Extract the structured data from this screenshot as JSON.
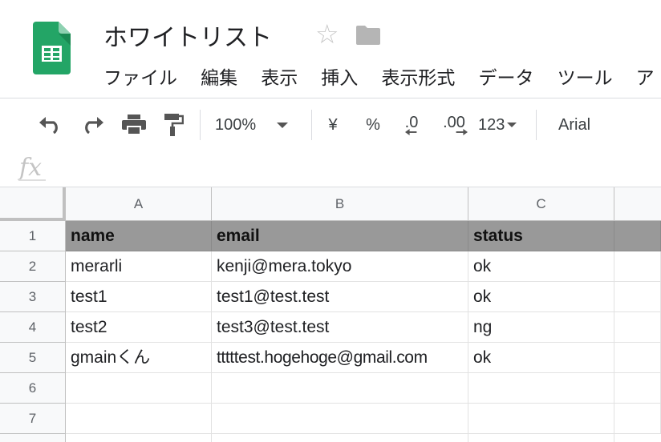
{
  "document": {
    "title": "ホワイトリスト"
  },
  "menu": {
    "items": [
      "ファイル",
      "編集",
      "表示",
      "挿入",
      "表示形式",
      "データ",
      "ツール",
      "ア"
    ]
  },
  "toolbar": {
    "zoom": "100%",
    "currency": "¥",
    "percent": "%",
    "decrease_decimal": ".0",
    "increase_decimal": ".00",
    "more_formats": "123",
    "font": "Arial"
  },
  "formula_bar": {
    "fx_label": "fx"
  },
  "grid": {
    "columns": [
      "A",
      "B",
      "C"
    ],
    "rows": [
      "1",
      "2",
      "3",
      "4",
      "5",
      "6",
      "7"
    ],
    "cells": [
      [
        "name",
        "email",
        "status"
      ],
      [
        "merarli",
        "kenji@mera.tokyo",
        "ok"
      ],
      [
        "test1",
        "test1@test.test",
        "ok"
      ],
      [
        "test2",
        "test3@test.test",
        "ng"
      ],
      [
        "gmainくん",
        "tttttest.hogehoge@gmail.com",
        "ok"
      ],
      [
        "",
        "",
        ""
      ],
      [
        "",
        "",
        ""
      ]
    ]
  },
  "colors": {
    "header_fill": "#999999",
    "logo_green": "#0f9d58"
  }
}
